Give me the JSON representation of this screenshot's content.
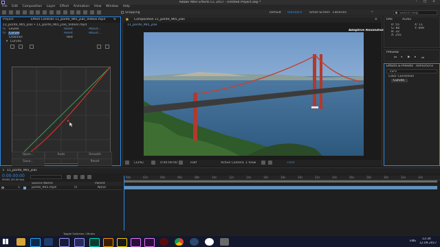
{
  "app": {
    "title": "Adobe After Effects CC 2017 - Untitled Project.aep *",
    "window_buttons": [
      "–",
      "□",
      "×"
    ],
    "menu": [
      "File",
      "Edit",
      "Composition",
      "Layer",
      "Effect",
      "Animation",
      "View",
      "Window",
      "Help"
    ]
  },
  "toolbar": {
    "snapping_label": "Snapping",
    "workspaces": [
      "Default",
      "Standard",
      "Small Screen",
      "Libraries"
    ],
    "workspace_active": "Standard",
    "search_placeholder": "Search Help"
  },
  "effect_panel": {
    "tabs": [
      "Project",
      "Effect Controls 11_ponte_965_jsas_Videos.mp4"
    ],
    "source_line": "11_ponte_965_jsas • 11_ponte_965_jsas_Videos.mp4",
    "rows": [
      {
        "name": "Levels",
        "c1": "Reset",
        "c2": "About..."
      },
      {
        "name": "Curves",
        "c1": "Reset",
        "c2": "About..."
      },
      {
        "name": "Channel:",
        "c1": "Red",
        "c2": ""
      }
    ],
    "curves_label": "Curves",
    "curve_buttons": [
      "Open...",
      "Auto",
      "Smooth",
      "Save...",
      "Reset"
    ]
  },
  "composition": {
    "tab": "Composition 11_ponte_965_jsas",
    "subtab": "11_ponte_965_jsas",
    "overlay": "Adaptive Resolution (1/3)",
    "footer": {
      "zoom": "(33%)",
      "timecode": "0:00:00:00",
      "quality": "Half",
      "camera": "Active Camera",
      "view": "1 View",
      "offset": "+0.0"
    }
  },
  "info": {
    "tabs": [
      "Info",
      "Audio"
    ],
    "lines": [
      "R: 55",
      "G: 80",
      "B: 32",
      "A: 255"
    ],
    "coords": [
      "X: 11",
      "Y: 499"
    ]
  },
  "preview": {
    "title": "Preview"
  },
  "effects_presets": {
    "tabs": [
      "Effects & Presets",
      "Reflections"
    ],
    "search_value": "curv",
    "category": "Color Correction",
    "item": "Curves"
  },
  "timeline": {
    "tab": "11_ponte_965_jsas",
    "timecode": "0:00:00:00",
    "timecode_sub": "00000 (25.00 fps)",
    "search_placeholder": "",
    "columns": {
      "source": "Source Name",
      "parent": "Parent"
    },
    "layers": [
      {
        "num": "1",
        "name": "ponte_965.mp4",
        "parent": "None"
      }
    ],
    "ticks": [
      "00s",
      "02s",
      "04s",
      "06s",
      "08s",
      "10s",
      "12s",
      "14s",
      "16s",
      "18s",
      "20s",
      "22s",
      "24s",
      "26s",
      "28s",
      "30s",
      "32s",
      "34s"
    ],
    "footer": "Toggle Switches / Modes"
  },
  "taskbar": {
    "apps": [
      "Photoshop",
      "Premiere",
      "After Effects",
      "After Effects",
      "Audition",
      "Illustrator",
      "Premiere Pro",
      "Premiere Pro",
      "Recorder",
      "Chrome",
      "Steam",
      "Yandex",
      "Files"
    ],
    "lang": "ENG",
    "time": "13:30",
    "date": "12.09.2017"
  },
  "colors": {
    "accent": "#2d8ceb",
    "curve_red": "#d9352c",
    "curve_green": "#3f9e55",
    "timeline_blue": "#6ea7d8"
  }
}
